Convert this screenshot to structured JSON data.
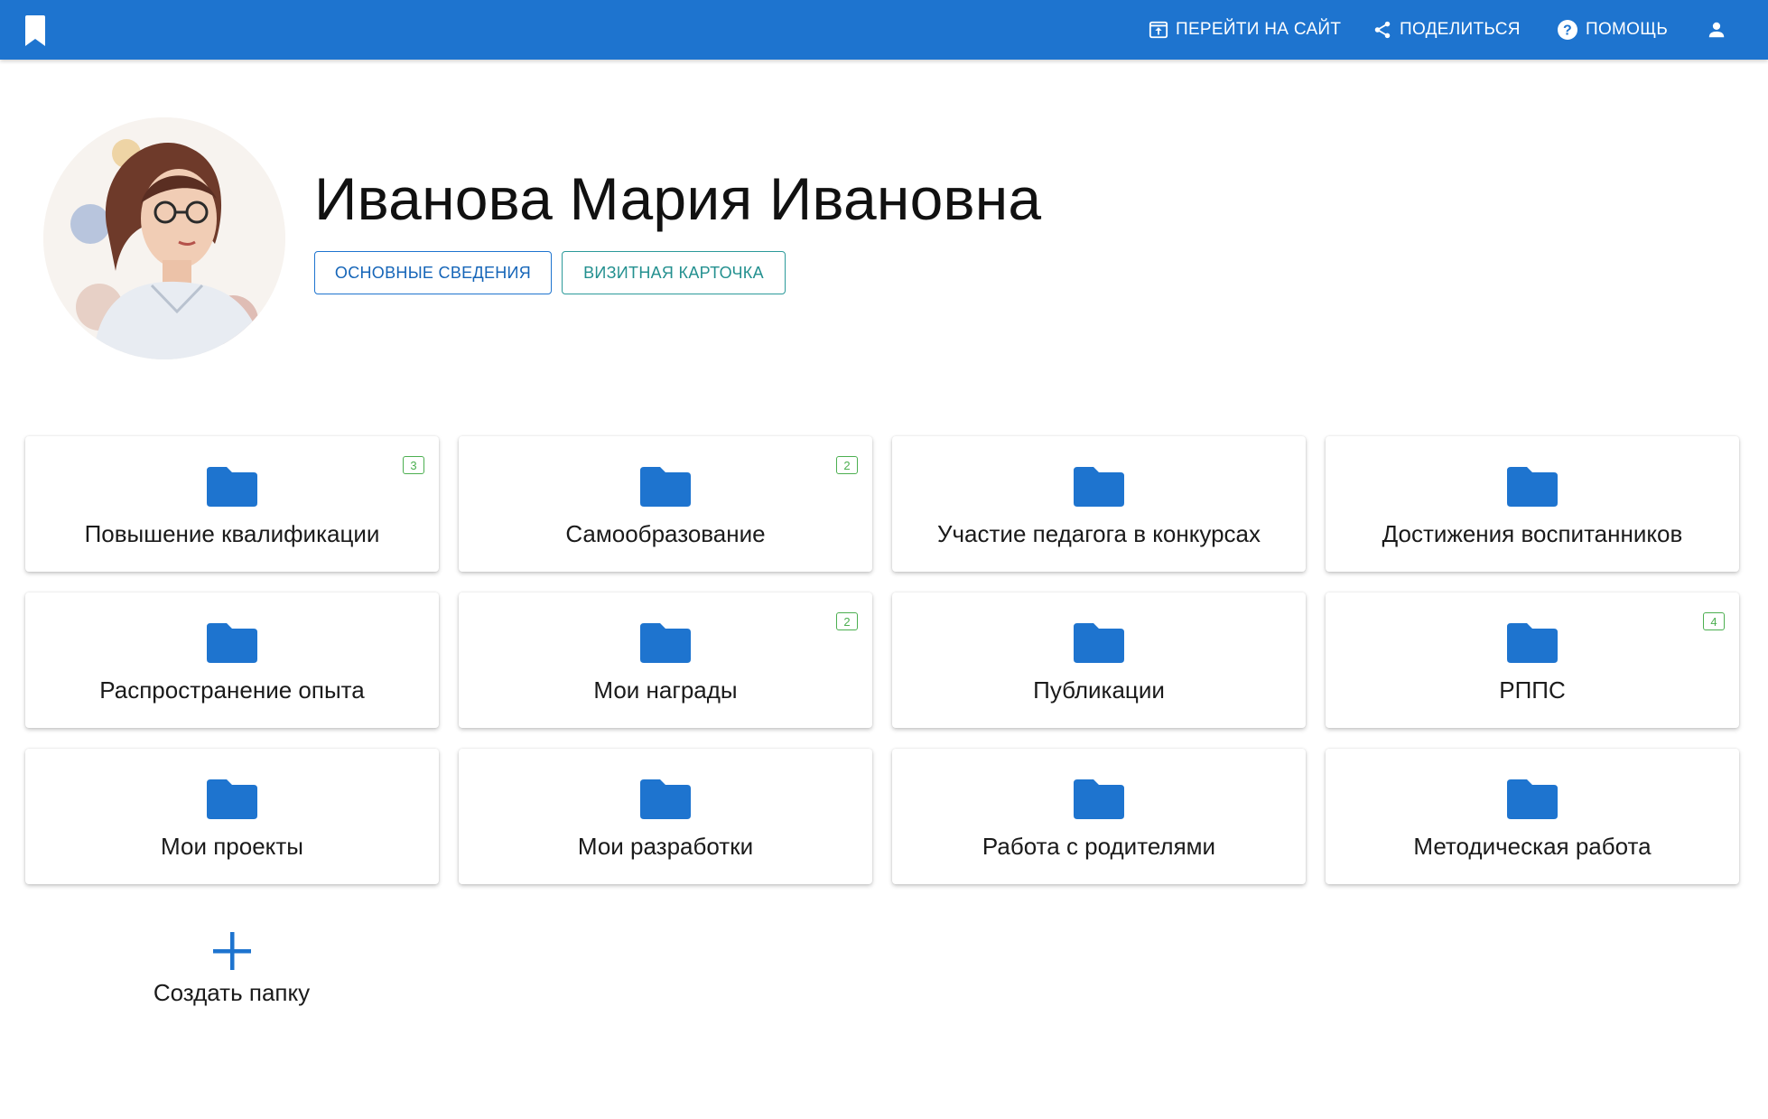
{
  "colors": {
    "topbar": "#1e74cf",
    "folder": "#1e74cf",
    "badge": "#4caf50",
    "secondary_button": "#2c9a9a"
  },
  "header": {
    "bookmark_icon": "bookmark-icon",
    "nav": [
      {
        "label": "ПЕРЕЙТИ НА САЙТ",
        "icon": "open-in-browser-icon"
      },
      {
        "label": "ПОДЕЛИТЬСЯ",
        "icon": "share-icon"
      },
      {
        "label": "ПОМОЩЬ",
        "icon": "help-circle-icon"
      }
    ],
    "user_icon": "account-icon"
  },
  "profile": {
    "name": "Иванова Мария Ивановна",
    "buttons": {
      "main_info": "ОСНОВНЫЕ СВЕДЕНИЯ",
      "business_card": "ВИЗИТНАЯ КАРТОЧКА"
    }
  },
  "folders": [
    {
      "label": "Повышение квалификации",
      "badge": "3"
    },
    {
      "label": "Самообразование",
      "badge": "2"
    },
    {
      "label": "Участие педагога в конкурсах",
      "badge": null
    },
    {
      "label": "Достижения воспитанников",
      "badge": null
    },
    {
      "label": "Распространение опыта",
      "badge": null
    },
    {
      "label": "Мои награды",
      "badge": "2"
    },
    {
      "label": "Публикации",
      "badge": null
    },
    {
      "label": "РППС",
      "badge": "4"
    },
    {
      "label": "Мои проекты",
      "badge": null
    },
    {
      "label": "Мои разработки",
      "badge": null
    },
    {
      "label": "Работа с родителями",
      "badge": null
    },
    {
      "label": "Методическая работа",
      "badge": null
    }
  ],
  "create_folder": {
    "label": "Создать папку",
    "icon": "plus-icon"
  }
}
